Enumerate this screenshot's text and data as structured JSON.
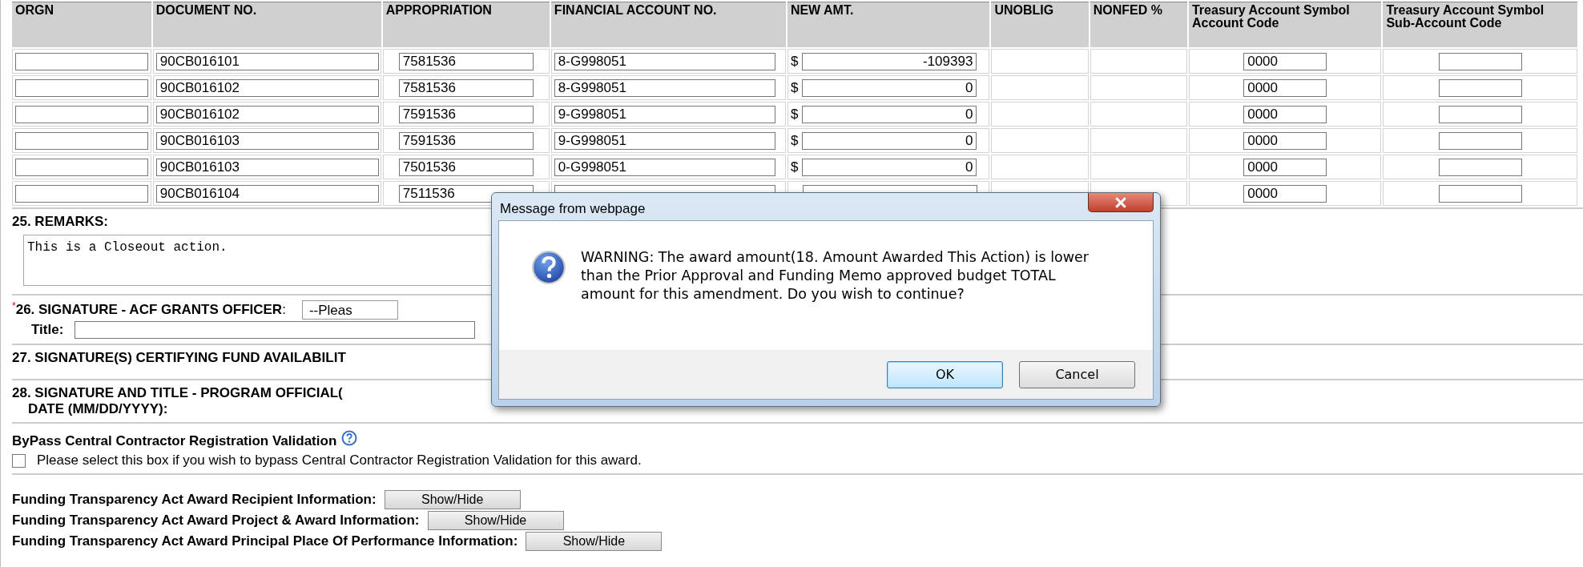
{
  "table": {
    "columns": [
      "ORGN",
      "DOCUMENT NO.",
      "APPROPRIATION",
      "FINANCIAL ACCOUNT NO.",
      "NEW AMT.",
      "UNOBLIG",
      "NONFED %",
      "Treasury Account Symbol Account Code",
      "Treasury Account Symbol Sub-Account Code"
    ],
    "rows": [
      {
        "document_no": "90CB016101",
        "appropriation": "7581536",
        "financial_account_no": "8-G998051",
        "currency": "$",
        "new_amt": "-109393",
        "tas_account_code": "0000"
      },
      {
        "document_no": "90CB016102",
        "appropriation": "7581536",
        "financial_account_no": "8-G998051",
        "currency": "$",
        "new_amt": "0",
        "tas_account_code": "0000"
      },
      {
        "document_no": "90CB016102",
        "appropriation": "7591536",
        "financial_account_no": "9-G998051",
        "currency": "$",
        "new_amt": "0",
        "tas_account_code": "0000"
      },
      {
        "document_no": "90CB016103",
        "appropriation": "7591536",
        "financial_account_no": "9-G998051",
        "currency": "$",
        "new_amt": "0",
        "tas_account_code": "0000"
      },
      {
        "document_no": "90CB016103",
        "appropriation": "7501536",
        "financial_account_no": "0-G998051",
        "currency": "$",
        "new_amt": "0",
        "tas_account_code": "0000"
      },
      {
        "document_no": "90CB016104",
        "appropriation": "7511536",
        "tas_account_code": "0000"
      }
    ]
  },
  "remarks": {
    "label": "25. REMARKS:",
    "value": "This is a Closeout action."
  },
  "signature_26": {
    "required_mark": "*",
    "label": "**26. SIGNATURE - ACF GRANTS OFFICER**:",
    "select_value": "--Pleas",
    "title_label": "Title:"
  },
  "section_27": {
    "label": "27. SIGNATURE(S) CERTIFYING FUND AVAILABILIT"
  },
  "section_28": {
    "label": "28. SIGNATURE AND TITLE - PROGRAM OFFICIAL(",
    "date_label": "DATE (MM/DD/YYYY):"
  },
  "bypass": {
    "title": "ByPass Central Contractor Registration Validation",
    "checkbox_label": "Please select this box if you wish to bypass Central Contractor Registration Validation for this award.",
    "checked": false
  },
  "funding_sections": [
    {
      "label": "Funding Transparency Act Award Recipient Information:",
      "button": "Show/Hide"
    },
    {
      "label": "Funding Transparency Act Award Project & Award Information:",
      "button": "Show/Hide"
    },
    {
      "label": "Funding Transparency Act Award Principal Place Of Performance Information:",
      "button": "Show/Hide"
    }
  ],
  "dialog": {
    "title": "Message from webpage",
    "message": "WARNING: The award amount(18. Amount Awarded This Action) is lower than the Prior Approval and Funding Memo approved budget TOTAL amount for this amendment. Do you wish to continue?",
    "buttons": [
      {
        "label": "OK",
        "default": true
      },
      {
        "label": "Cancel",
        "default": false
      }
    ]
  }
}
